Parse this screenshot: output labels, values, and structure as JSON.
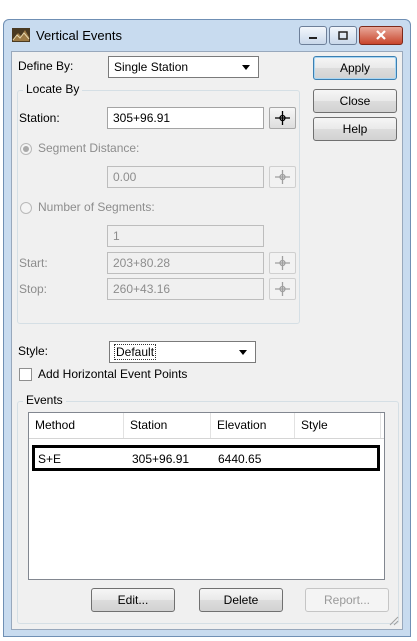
{
  "window": {
    "title": "Vertical Events",
    "title_icon": "vertical-events-app-icon"
  },
  "define_by": {
    "label": "Define By:",
    "selected": "Single Station"
  },
  "buttons": {
    "apply": "Apply",
    "close": "Close",
    "help": "Help",
    "edit": "Edit...",
    "delete": "Delete",
    "report": "Report..."
  },
  "locate_by": {
    "title": "Locate By",
    "station_label": "Station:",
    "station_value": "305+96.91",
    "segment_distance_label": "Segment Distance:",
    "segment_distance_value": "0.00",
    "number_segments_label": "Number of Segments:",
    "number_segments_value": "1",
    "start_label": "Start:",
    "start_value": "203+80.28",
    "stop_label": "Stop:",
    "stop_value": "260+43.16"
  },
  "style": {
    "label": "Style:",
    "selected": "Default"
  },
  "add_horizontal": {
    "label": "Add Horizontal Event Points",
    "checked": false
  },
  "events": {
    "title": "Events",
    "columns": [
      "Method",
      "Station",
      "Elevation",
      "Style"
    ],
    "rows": [
      {
        "method": "S+E",
        "station": "305+96.91",
        "elevation": "6440.65",
        "style": ""
      }
    ]
  }
}
